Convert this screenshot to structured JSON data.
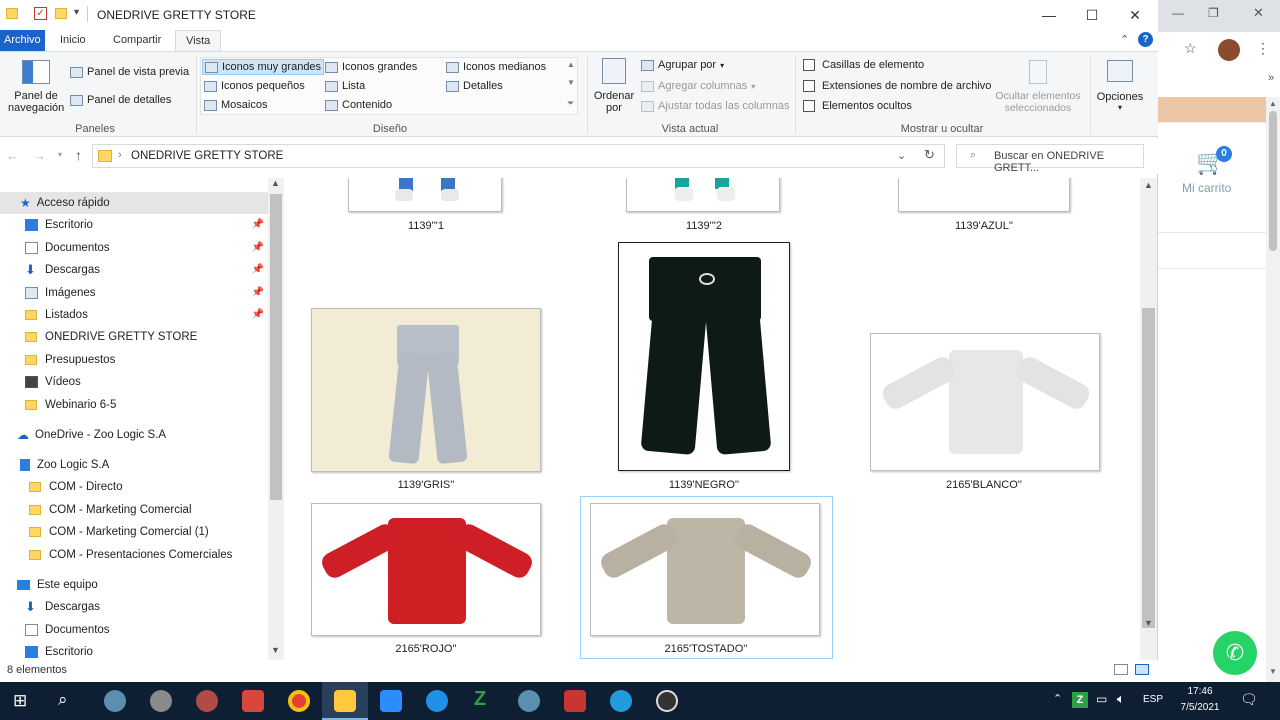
{
  "window": {
    "title": "ONEDRIVE GRETTY STORE",
    "controls": {
      "minimize": "—",
      "maximize": "☐",
      "close": "✕"
    }
  },
  "ribbon_tabs": [
    "Archivo",
    "Inicio",
    "Compartir",
    "Vista"
  ],
  "ribbon": {
    "panes": {
      "nav_pane": "Panel de navegación",
      "preview_pane": "Panel de vista previa",
      "details_pane": "Panel de detalles",
      "group": "Paneles"
    },
    "layout": {
      "items": [
        "Iconos muy grandes",
        "Iconos grandes",
        "Iconos medianos",
        "Iconos pequeños",
        "Lista",
        "Detalles",
        "Mosaicos",
        "Contenido"
      ],
      "group": "Diseño"
    },
    "current_view": {
      "sort": "Ordenar por",
      "group_by": "Agrupar por",
      "add_columns": "Agregar columnas",
      "fit_columns": "Ajustar todas las columnas",
      "group": "Vista actual"
    },
    "show_hide": {
      "item_checkboxes": "Casillas de elemento",
      "file_extensions": "Extensiones de nombre de archivo",
      "hidden_items": "Elementos ocultos",
      "hide_selected": "Ocultar elementos seleccionados",
      "group": "Mostrar u ocultar"
    },
    "options": "Opciones"
  },
  "address": {
    "path": "ONEDRIVE GRETTY STORE",
    "search_placeholder": "Buscar en ONEDRIVE GRETT..."
  },
  "nav": {
    "quick_access": "Acceso rápido",
    "quick_items": [
      "Escritorio",
      "Documentos",
      "Descargas",
      "Imágenes",
      "Listados",
      "ONEDRIVE GRETTY STORE",
      "Presupuestos",
      "Vídeos",
      "Webinario 6-5"
    ],
    "onedrive": "OneDrive - Zoo Logic S.A",
    "org": "Zoo Logic S.A",
    "org_items": [
      "COM - Directo",
      "COM - Marketing Comercial",
      "COM - Marketing Comercial (1)",
      "COM - Presentaciones Comerciales"
    ],
    "this_pc": "Este equipo",
    "pc_items": [
      "Descargas",
      "Documentos",
      "Escritorio"
    ]
  },
  "files": [
    {
      "name": "1139'''1"
    },
    {
      "name": "1139'''2"
    },
    {
      "name": "1139'AZUL''"
    },
    {
      "name": "1139'GRIS''"
    },
    {
      "name": "1139'NEGRO''"
    },
    {
      "name": "2165'BLANCO''"
    },
    {
      "name": "2165'ROJO''"
    },
    {
      "name": "2165'TOSTADO''"
    }
  ],
  "status": {
    "count": "8 elementos"
  },
  "browser": {
    "cart_label": "Mi carrito",
    "cart_count": "0"
  },
  "taskbar": {
    "time": "17:46",
    "date": "7/5/2021",
    "lang": "ESP"
  },
  "colors": {
    "accent": "#1a64c8",
    "taskbar": "#0f1f33",
    "whatsapp": "#25d366"
  }
}
